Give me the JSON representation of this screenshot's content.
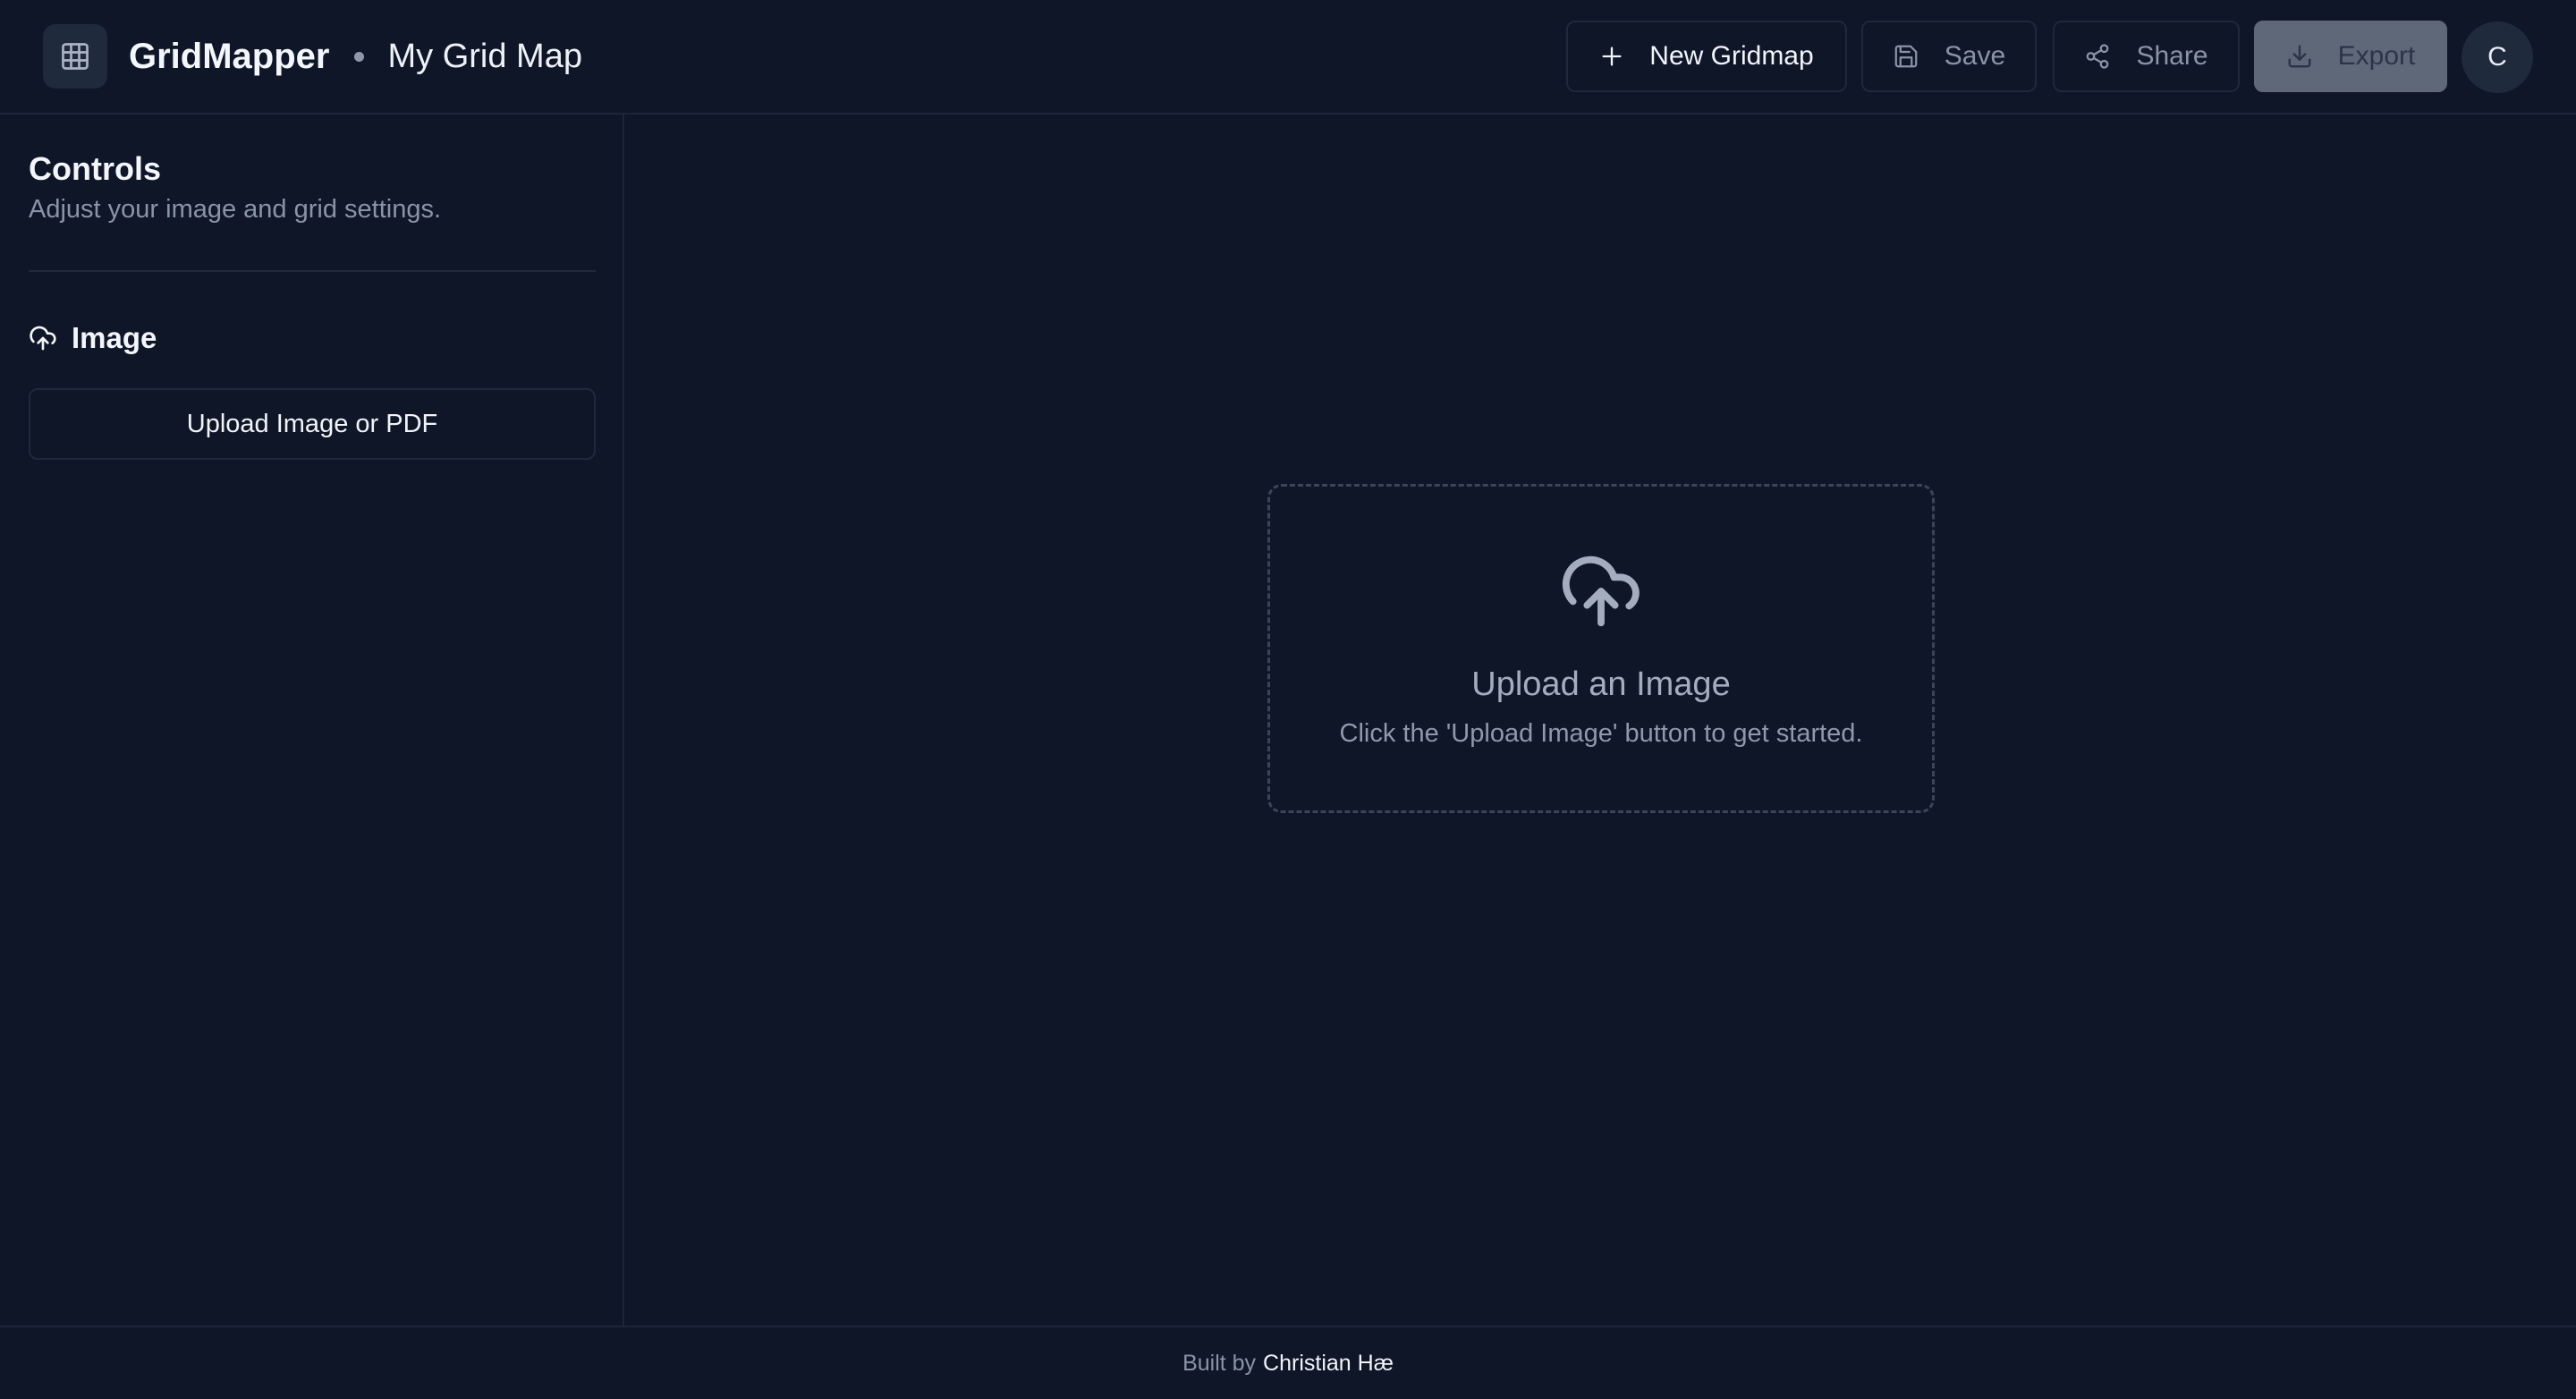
{
  "header": {
    "app_name": "GridMapper",
    "map_name": "My Grid Map",
    "buttons": {
      "new_gridmap": "New Gridmap",
      "save": "Save",
      "share": "Share",
      "export": "Export"
    },
    "avatar_initial": "C"
  },
  "sidebar": {
    "title": "Controls",
    "subtitle": "Adjust your image and grid settings.",
    "image_section": {
      "label": "Image",
      "upload_button": "Upload Image or PDF"
    }
  },
  "main": {
    "dropzone": {
      "title": "Upload an Image",
      "subtitle": "Click the 'Upload Image' button to get started."
    }
  },
  "footer": {
    "prefix": "Built by",
    "author": "Christian Hæ"
  },
  "colors": {
    "background": "#0e1628",
    "border": "#1e293b",
    "text_primary": "#f3f6fb",
    "text_muted": "#8a94a7",
    "export_button_bg": "#5f6878"
  }
}
